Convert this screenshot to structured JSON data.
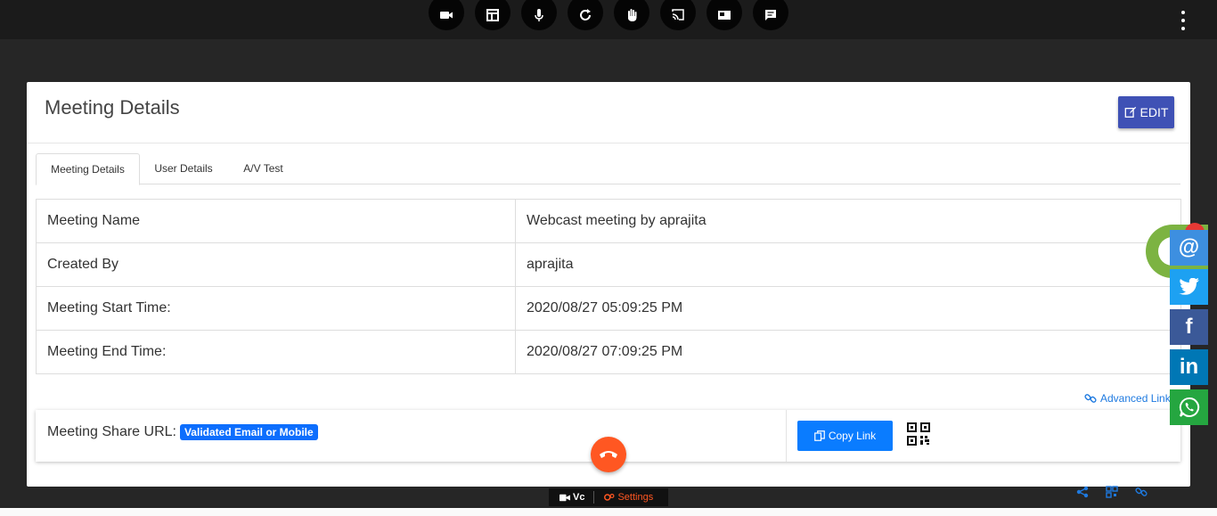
{
  "toolbar": {
    "buttons": [
      "video-icon",
      "layout-icon",
      "mic-icon",
      "refresh-icon",
      "raise-hand-icon",
      "cast-icon",
      "pip-icon",
      "chat-icon"
    ]
  },
  "card": {
    "title": "Meeting Details",
    "edit_label": "EDIT"
  },
  "tabs": [
    {
      "label": "Meeting Details",
      "active": true
    },
    {
      "label": "User Details",
      "active": false
    },
    {
      "label": "A/V Test",
      "active": false
    }
  ],
  "details": [
    {
      "label": "Meeting Name",
      "value": "Webcast meeting by aprajita"
    },
    {
      "label": "Created By",
      "value": "aprajita"
    },
    {
      "label": "Meeting Start Time:",
      "value": "2020/08/27 05:09:25 PM"
    },
    {
      "label": "Meeting End Time:",
      "value": "2020/08/27 07:09:25 PM"
    }
  ],
  "advanced_link": "Advanced Link",
  "share": {
    "label": "Meeting Share URL:",
    "badge": "Validated Email or Mobile",
    "copy_label": "Copy Link"
  },
  "footer": {
    "vc_label": "Vc",
    "settings_label": "Settings"
  },
  "social": [
    {
      "name": "email",
      "glyph": "@",
      "color": "#3d8fe0"
    },
    {
      "name": "twitter",
      "glyph": "",
      "color": "#1da1f2"
    },
    {
      "name": "facebook",
      "glyph": "f",
      "color": "#3b5998"
    },
    {
      "name": "linkedin",
      "glyph": "in",
      "color": "#0077b5"
    },
    {
      "name": "whatsapp",
      "glyph": "",
      "color": "#25a640"
    }
  ],
  "colors": {
    "accent": "#3f51b5",
    "primary": "#0a7cff",
    "hangup": "#ff5722",
    "chat": "#7cb342"
  }
}
